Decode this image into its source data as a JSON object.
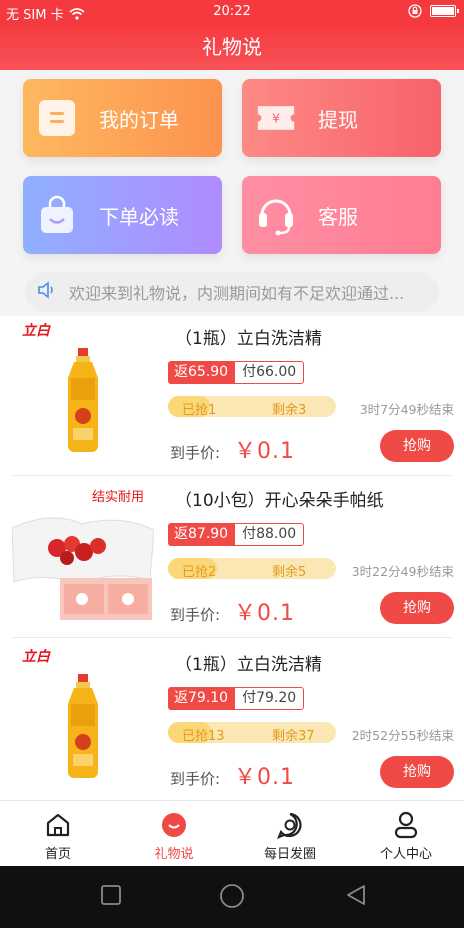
{
  "status_bar": {
    "carrier": "无 SIM 卡",
    "time": "20:22"
  },
  "header": {
    "title": "礼物说"
  },
  "tiles": [
    {
      "label": "我的订单",
      "icon": "order-icon"
    },
    {
      "label": "提现",
      "icon": "yen-ticket-icon"
    },
    {
      "label": "下单必读",
      "icon": "shopping-bag-icon"
    },
    {
      "label": "客服",
      "icon": "headset-icon"
    }
  ],
  "notice": {
    "text": "欢迎来到礼物说，内测期间如有不足欢迎通过...",
    "icon": "speaker-icon"
  },
  "products": [
    {
      "brand_logo": "立白",
      "name": "（1瓶）立白洗洁精",
      "rebate": "返65.90",
      "pay": "付66.00",
      "sold": "已抢1",
      "remaining": "剩余3",
      "progress": 0.25,
      "countdown": "3时7分49秒结束",
      "price_label": "到手价:",
      "price": "￥0.1",
      "buy_label": "抢购"
    },
    {
      "brand_logo": "结实耐用",
      "name": "（10小包）开心朵朵手帕纸",
      "rebate": "返87.90",
      "pay": "付88.00",
      "sold": "已抢2",
      "remaining": "剩余5",
      "progress": 0.29,
      "countdown": "3时22分49秒结束",
      "price_label": "到手价:",
      "price": "￥0.1",
      "buy_label": "抢购"
    },
    {
      "brand_logo": "立白",
      "name": "（1瓶）立白洗洁精",
      "rebate": "返79.10",
      "pay": "付79.20",
      "sold": "已抢13",
      "remaining": "剩余37",
      "progress": 0.26,
      "countdown": "2时52分55秒结束",
      "price_label": "到手价:",
      "price": "￥0.1",
      "buy_label": "抢购"
    }
  ],
  "tabbar": [
    {
      "label": "首页",
      "icon": "home-icon",
      "active": false
    },
    {
      "label": "礼物说",
      "icon": "gift-talk-icon",
      "active": true
    },
    {
      "label": "每日发圈",
      "icon": "daily-circle-icon",
      "active": false
    },
    {
      "label": "个人中心",
      "icon": "profile-icon",
      "active": false
    }
  ],
  "colors": {
    "primary": "#f53a3f",
    "price": "#f04a47",
    "progress": "#fad878"
  }
}
